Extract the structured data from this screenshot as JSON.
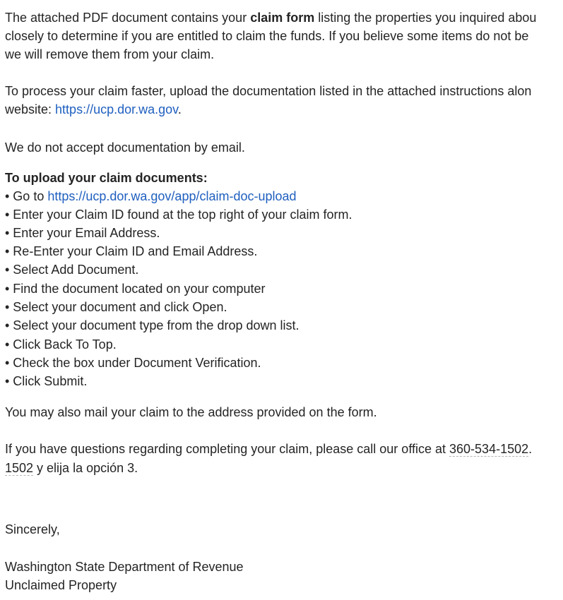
{
  "p1": {
    "line1_a": "The attached PDF document contains your ",
    "line1_bold": "claim form",
    "line1_b": " listing the properties you inquired abou",
    "line2": "closely to determine if you are entitled to claim the funds.  If you believe some items do not be",
    "line3": "we will remove them from your claim."
  },
  "p2": {
    "line1": "To process your claim faster, upload the documentation listed in the attached instructions alon",
    "line2_a": "website:  ",
    "link": "https://ucp.dor.wa.gov",
    "line2_b": "."
  },
  "p3": {
    "text": "We do not accept documentation by email."
  },
  "upload": {
    "heading": "To upload your claim documents:",
    "step1_prefix": "• Go to ",
    "step1_link": "https://ucp.dor.wa.gov/app/claim-doc-upload",
    "steps": [
      "• Enter your Claim ID found at the top right of your claim form.",
      "• Enter your Email Address.",
      "• Re-Enter your Claim ID and Email Address.",
      "• Select Add Document.",
      "• Find the document located on your computer",
      "• Select your document and click Open.",
      "• Select your document type from the drop down list.",
      "• Click Back To Top.",
      "• Check the box under Document Verification.",
      "• Click Submit."
    ]
  },
  "p4": {
    "text": "You may also mail your claim to the address provided on the form."
  },
  "p5": {
    "line1_a": "If you have questions regarding completing your claim, please call our office at ",
    "phone": "360-534-1502",
    "line1_b": ".",
    "line2_phone": "1502",
    "line2_rest": " y elija la opción 3."
  },
  "closing": {
    "sincerely": "Sincerely,",
    "org1": "Washington State Department of Revenue",
    "org2": "Unclaimed Property"
  }
}
